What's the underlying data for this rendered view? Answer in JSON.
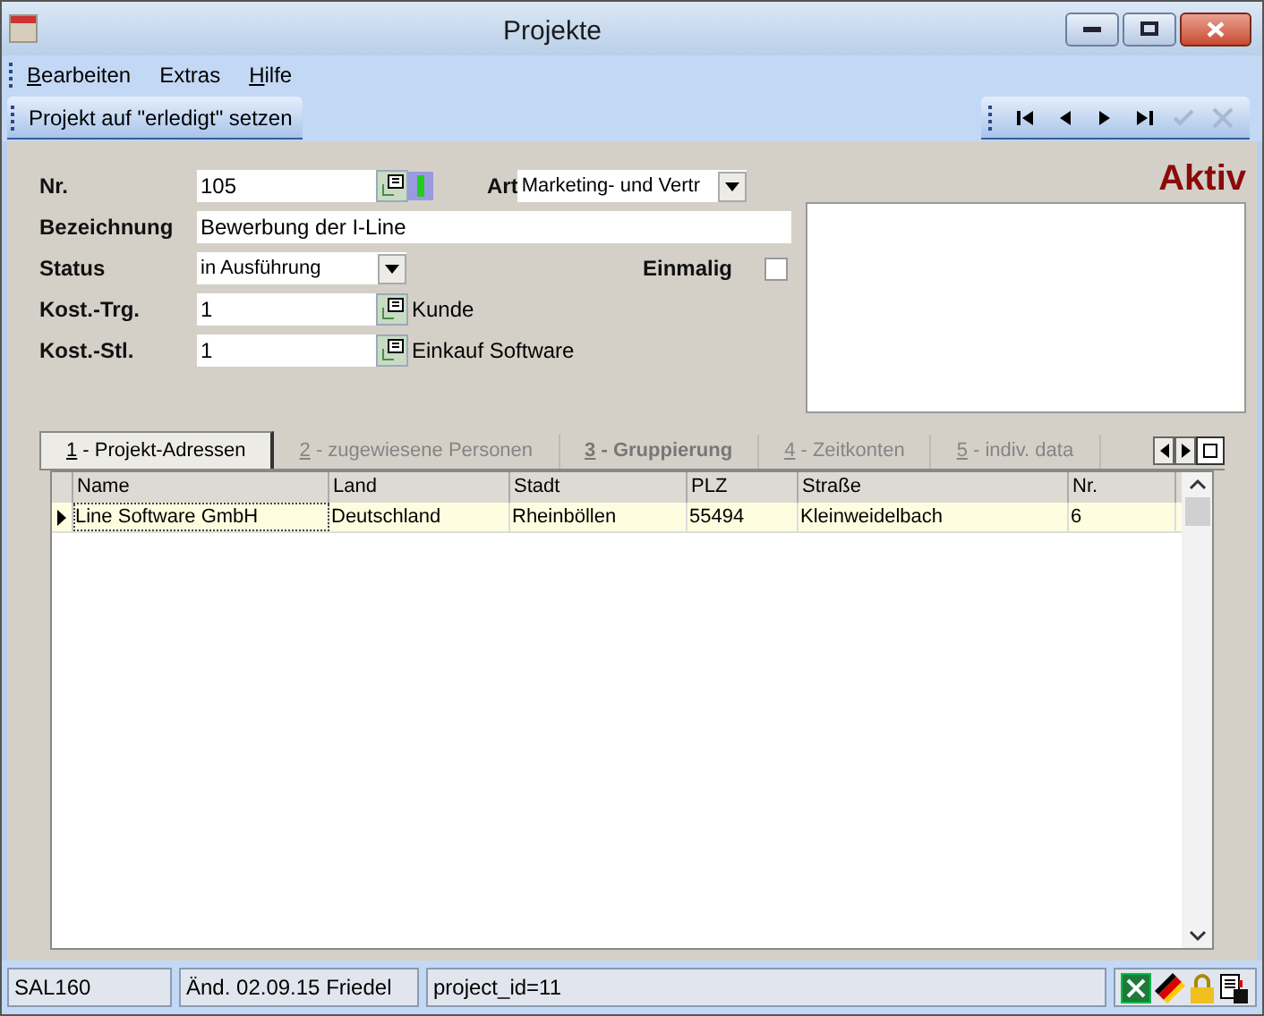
{
  "window": {
    "title": "Projekte"
  },
  "menu": [
    {
      "label": "Bearbeiten",
      "mnemonic": true
    },
    {
      "label": "Extras",
      "mnemonic": false
    },
    {
      "label": "Hilfe",
      "mnemonic": true
    }
  ],
  "action_button": "Projekt auf \"erledigt\" setzen",
  "nav_buttons": [
    {
      "kind": "first",
      "disabled": false
    },
    {
      "kind": "prev",
      "disabled": false
    },
    {
      "kind": "next",
      "disabled": false
    },
    {
      "kind": "last",
      "disabled": false
    },
    {
      "kind": "confirm",
      "disabled": true
    },
    {
      "kind": "cancel",
      "disabled": true
    }
  ],
  "status_badge": "Aktiv",
  "form": {
    "nr": {
      "label": "Nr.",
      "value": "105"
    },
    "art": {
      "label": "Art",
      "value": "Marketing- und Vertr"
    },
    "bezeichnung": {
      "label": "Bezeichnung",
      "value": "Bewerbung der I-Line"
    },
    "status": {
      "label": "Status",
      "value": "in Ausführung"
    },
    "einmalig": {
      "label": "Einmalig",
      "checked": false
    },
    "kost_trg": {
      "label": "Kost.-Trg.",
      "value": "1",
      "lookup": "Kunde"
    },
    "kost_stl": {
      "label": "Kost.-Stl.",
      "value": "1",
      "lookup": "Einkauf Software"
    }
  },
  "tabs": [
    {
      "label": "1 - Projekt-Adressen",
      "selected": true,
      "disabled": false
    },
    {
      "label": "2 - zugewiesene Personen",
      "selected": false,
      "disabled": true
    },
    {
      "label": "3 - Gruppierung",
      "selected": false,
      "disabled": false
    },
    {
      "label": "4 - Zeitkonten",
      "selected": false,
      "disabled": true
    },
    {
      "label": "5 - indiv. data",
      "selected": false,
      "disabled": true
    }
  ],
  "table": {
    "columns": [
      "Name",
      "Land",
      "Stadt",
      "PLZ",
      "Straße",
      "Nr."
    ],
    "rows": [
      {
        "cells": [
          "Line Software GmbH",
          "Deutschland",
          "Rheinböllen",
          "55494",
          "Kleinweidelbach",
          "6"
        ],
        "selected": true
      }
    ]
  },
  "status_bar": [
    "SAL160",
    "Änd. 02.09.15 Friedel",
    "project_id=11"
  ]
}
